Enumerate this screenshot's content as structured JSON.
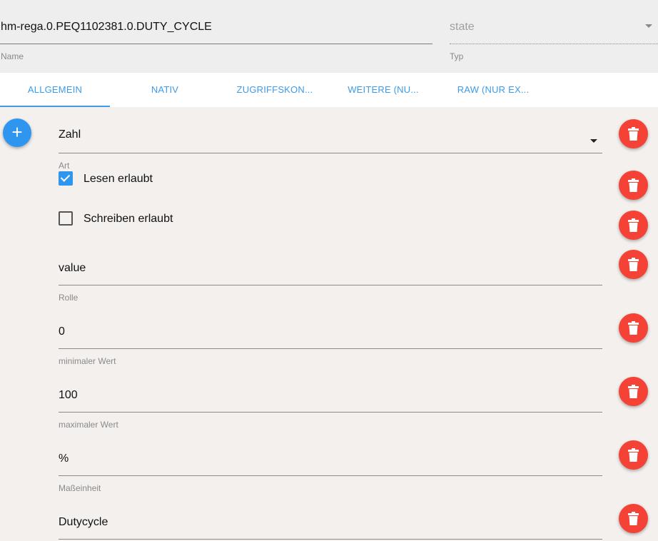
{
  "header": {
    "name_value": "hm-rega.0.PEQ1102381.0.DUTY_CYCLE",
    "name_label": "Name",
    "type_value": "state",
    "type_label": "Typ"
  },
  "tabs": [
    {
      "label": "ALLGEMEIN",
      "active": true
    },
    {
      "label": "NATIV",
      "active": false
    },
    {
      "label": "ZUGRIFFSKON...",
      "active": false
    },
    {
      "label": "WEITERE (NU...",
      "active": false
    },
    {
      "label": "RAW (NUR EX...",
      "active": false
    }
  ],
  "form": {
    "art": {
      "value": "Zahl",
      "label": "Art"
    },
    "read": {
      "label": "Lesen erlaubt",
      "checked": true
    },
    "write": {
      "label": "Schreiben erlaubt",
      "checked": false
    },
    "role": {
      "value": "value",
      "label": "Rolle"
    },
    "min": {
      "value": "0",
      "label": "minimaler Wert"
    },
    "max": {
      "value": "100",
      "label": "maximaler Wert"
    },
    "unit": {
      "value": "%",
      "label": "Maßeinheit"
    },
    "desc": {
      "value": "Dutycycle"
    }
  },
  "icons": {
    "add": "plus-icon",
    "delete": "trash-icon",
    "dropdown": "caret-down-icon"
  },
  "colors": {
    "accent": "#2f96f0",
    "delete": "#f44336",
    "tab_text": "#3d9be9"
  }
}
